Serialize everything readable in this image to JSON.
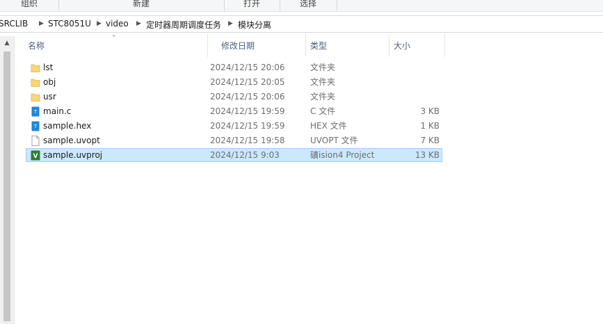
{
  "ribbon": {
    "groups": [
      "组织",
      "新建",
      "打开",
      "选择"
    ]
  },
  "breadcrumb": {
    "items": [
      "SRCLIB",
      "STC8051U",
      "video",
      "定时器周期调度任务",
      "模块分离"
    ]
  },
  "columns": {
    "name": "名称",
    "date": "修改日期",
    "type": "类型",
    "size": "大小"
  },
  "files": [
    {
      "name": "lst",
      "date": "2024/12/15 20:06",
      "type": "文件夹",
      "size": "",
      "icon": "folder-icon"
    },
    {
      "name": "obj",
      "date": "2024/12/15 20:05",
      "type": "文件夹",
      "size": "",
      "icon": "folder-icon"
    },
    {
      "name": "usr",
      "date": "2024/12/15 20:06",
      "type": "文件夹",
      "size": "",
      "icon": "folder-icon"
    },
    {
      "name": "main.c",
      "date": "2024/12/15 19:59",
      "type": "C 文件",
      "size": "3 KB",
      "icon": "text-file-icon"
    },
    {
      "name": "sample.hex",
      "date": "2024/12/15 19:59",
      "type": "HEX 文件",
      "size": "1 KB",
      "icon": "text-file-icon"
    },
    {
      "name": "sample.uvopt",
      "date": "2024/12/15 19:58",
      "type": "UVOPT 文件",
      "size": "7 KB",
      "icon": "blank-file-icon"
    },
    {
      "name": "sample.uvproj",
      "date": "2024/12/15 9:03",
      "type": "礦ision4 Project",
      "size": "13 KB",
      "icon": "uvision-project-icon",
      "selected": true
    }
  ],
  "colors": {
    "folder": "#f8d775",
    "text_file": "#1e88d6",
    "selection": "#cce8ff",
    "uvision": "#2e7d32"
  }
}
